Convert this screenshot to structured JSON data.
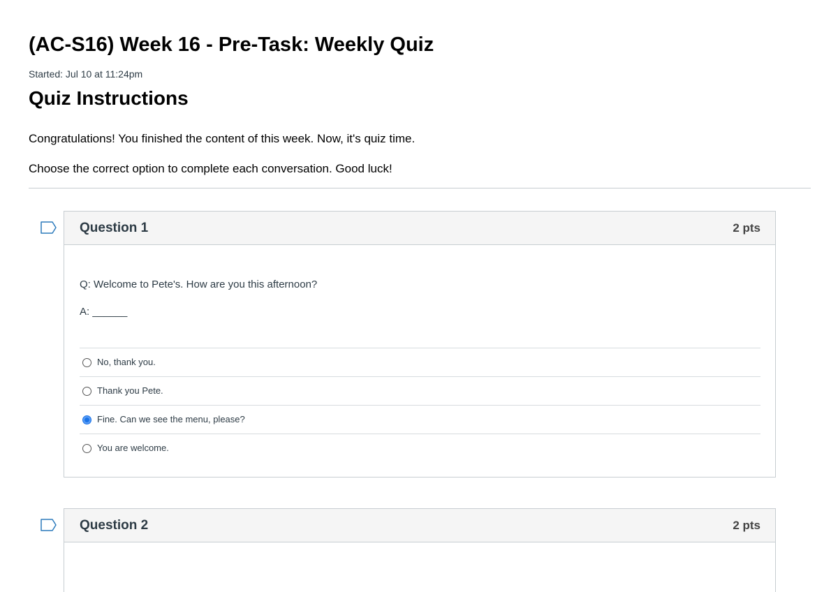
{
  "quiz": {
    "title": "(AC-S16) Week 16 - Pre-Task: Weekly Quiz",
    "started": "Started: Jul 10 at 11:24pm",
    "instructions_heading": "Quiz Instructions",
    "paragraphs": [
      "Congratulations! You finished the content of this week. Now, it's quiz time.",
      "Choose the correct option to complete each conversation. Good luck!"
    ]
  },
  "questions": [
    {
      "name": "Question 1",
      "points": "2 pts",
      "prompt_q": "Q: Welcome to Pete's. How are you this afternoon?",
      "prompt_a": "A: ______",
      "answers": [
        {
          "label": "No, thank you.",
          "selected": false
        },
        {
          "label": "Thank you Pete.",
          "selected": false
        },
        {
          "label": "Fine. Can we see the menu, please?",
          "selected": true
        },
        {
          "label": "You are welcome.",
          "selected": false
        }
      ]
    },
    {
      "name": "Question 2",
      "points": "2 pts"
    }
  ],
  "colors": {
    "selected_radio": "#1a73e8",
    "header_bg": "#f5f5f5",
    "border": "#c7cdd1",
    "flag_outline": "#2b7abc"
  },
  "icons": {
    "flag": "flag-question-icon",
    "radio": "radio-button-icon"
  }
}
